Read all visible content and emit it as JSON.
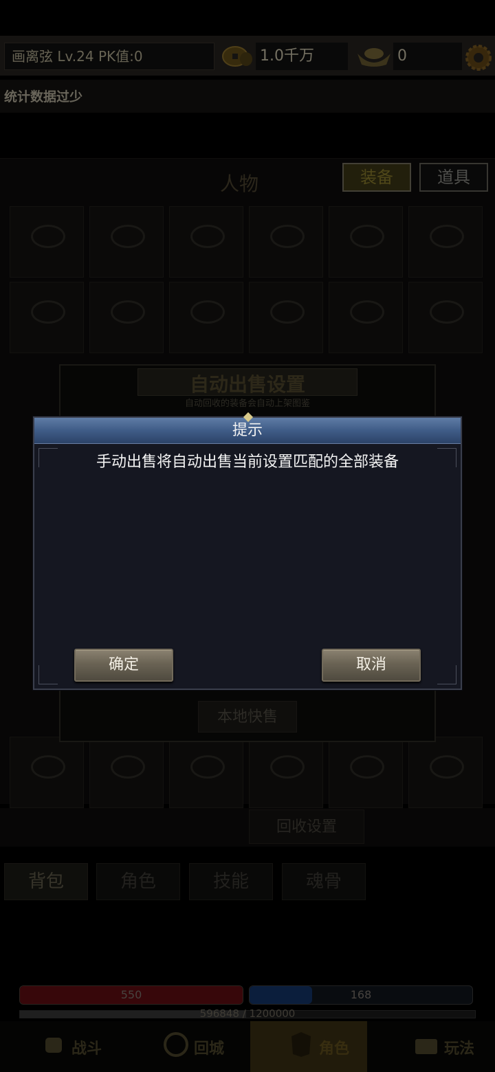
{
  "topbar": {
    "player_info": "画离弦  Lv.24 PK值:0",
    "gold": "1.0千万",
    "ingots": "0"
  },
  "stats_notice": "统计数据过少",
  "character_panel": {
    "title": "人物",
    "tabs": [
      {
        "label": "装备",
        "active": true
      },
      {
        "label": "道具",
        "active": false
      }
    ]
  },
  "auto_sell": {
    "title": "自动出售设置",
    "subtitle": "自动回收的装备会自动上架图鉴",
    "local_sell_label": "本地快售"
  },
  "recycle": {
    "settings_label": "回收设置"
  },
  "bottom_tabs": [
    {
      "label": "背包",
      "active": true
    },
    {
      "label": "角色",
      "active": false
    },
    {
      "label": "技能",
      "active": false
    },
    {
      "label": "魂骨",
      "active": false
    }
  ],
  "status": {
    "hp": "550",
    "mp": "168",
    "xp_text": "596848 / 1200000",
    "xp_fraction": 0.497,
    "hp_fraction": 1.0,
    "mp_fraction": 0.28
  },
  "nav": [
    {
      "label": "战斗",
      "icon": "fist-icon",
      "active": false
    },
    {
      "label": "回城",
      "icon": "portal-icon",
      "active": false
    },
    {
      "label": "角色",
      "icon": "helmet-icon",
      "active": true
    },
    {
      "label": "玩法",
      "icon": "chest-icon",
      "active": false
    }
  ],
  "dialog": {
    "title": "提示",
    "message": "手动出售将自动出售当前设置匹配的全部装备",
    "confirm_label": "确定",
    "cancel_label": "取消"
  },
  "colors": {
    "dialog_header": "#4a6792",
    "dialog_body": "#151721",
    "button": "#6a6354",
    "hp": "#c0141c",
    "mp": "#1d57b0"
  }
}
